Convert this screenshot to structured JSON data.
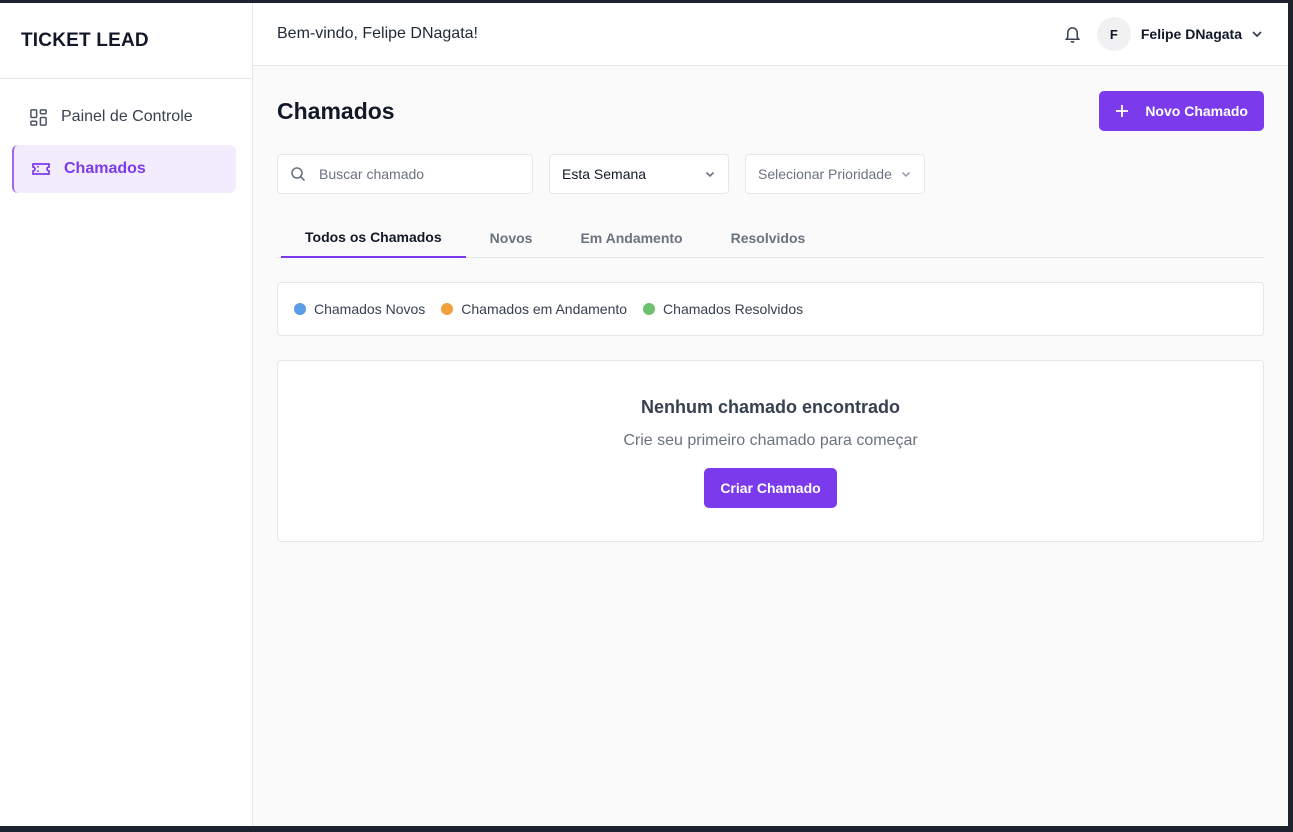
{
  "brand": "TICKET LEAD",
  "sidebar": {
    "items": [
      {
        "label": "Painel de Controle",
        "icon": "dashboard-icon",
        "active": false
      },
      {
        "label": "Chamados",
        "icon": "ticket-icon",
        "active": true
      }
    ]
  },
  "topbar": {
    "welcome": "Bem-vindo, Felipe DNagata!",
    "avatar_initial": "F",
    "username": "Felipe DNagata"
  },
  "page": {
    "title": "Chamados",
    "new_button": "Novo Chamado"
  },
  "filters": {
    "search_placeholder": "Buscar chamado",
    "period_value": "Esta Semana",
    "priority_placeholder": "Selecionar Prioridade"
  },
  "tabs": [
    {
      "label": "Todos os Chamados",
      "active": true
    },
    {
      "label": "Novos",
      "active": false
    },
    {
      "label": "Em Andamento",
      "active": false
    },
    {
      "label": "Resolvidos",
      "active": false
    }
  ],
  "legend": [
    {
      "label": "Chamados Novos",
      "color": "#5b9be8"
    },
    {
      "label": "Chamados em Andamento",
      "color": "#f0a03c"
    },
    {
      "label": "Chamados Resolvidos",
      "color": "#6cc070"
    }
  ],
  "empty_state": {
    "title": "Nenhum chamado encontrado",
    "subtitle": "Crie seu primeiro chamado para começar",
    "button": "Criar Chamado"
  },
  "colors": {
    "accent": "#7c3aed",
    "active_nav_bg": "#f3ecfd"
  }
}
